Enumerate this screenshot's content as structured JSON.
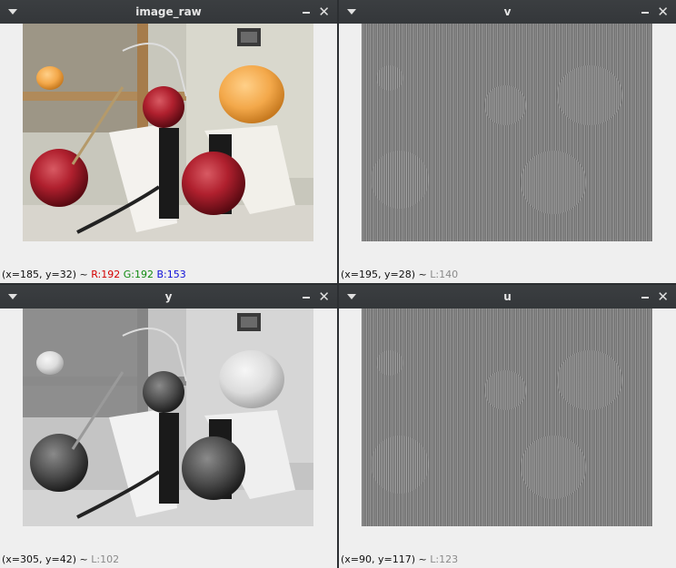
{
  "windows": [
    {
      "title": "image_raw",
      "status": {
        "coords": "(x=185, y=32) ~ ",
        "r": "R:192",
        "g": "G:192",
        "b": "B:153"
      }
    },
    {
      "title": "v",
      "status": {
        "coords": "(x=195, y=28) ~ ",
        "l": "L:140"
      }
    },
    {
      "title": "y",
      "status": {
        "coords": "(x=305, y=42) ~ ",
        "l": "L:102"
      }
    },
    {
      "title": "u",
      "status": {
        "coords": "(x=90, y=117) ~ ",
        "l": "L:123"
      }
    }
  ],
  "colors": {
    "titlebar": "#35383b",
    "window_bg": "#efefef",
    "red": "#d40000",
    "green": "#108a10",
    "blue": "#1010d8"
  },
  "icons": {
    "menu": "triangle-down-icon",
    "minimize": "minimize-icon",
    "close": "close-icon"
  }
}
